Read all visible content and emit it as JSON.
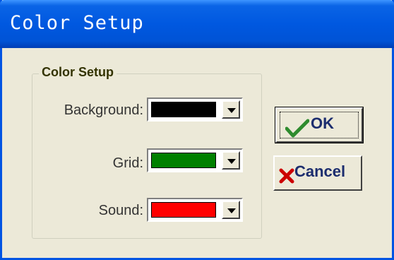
{
  "window": {
    "title": "Color Setup"
  },
  "group": {
    "title": "Color Setup"
  },
  "rows": [
    {
      "label": "Background:",
      "color": "#000000"
    },
    {
      "label": "Grid:",
      "color": "#008000"
    },
    {
      "label": "Sound:",
      "color": "#ff0000"
    }
  ],
  "buttons": {
    "ok_label": "OK",
    "cancel_label": "Cancel",
    "ok_icon": "checkmark-icon",
    "cancel_icon": "cross-icon"
  },
  "colors": {
    "title_bar": "#0058e0",
    "dialog_bg": "#ece9d8",
    "checkmark": "#2e8b2e",
    "cross": "#cc0000"
  }
}
